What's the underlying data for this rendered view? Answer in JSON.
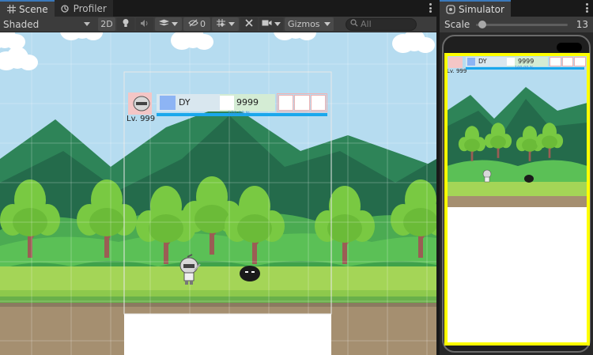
{
  "scene_tabs": [
    {
      "label": "Scene",
      "icon": "grid-icon",
      "active": true
    },
    {
      "label": "Profiler",
      "icon": "profiler-icon",
      "active": false
    }
  ],
  "simulator_tab": {
    "label": "Simulator",
    "icon": "simulator-icon"
  },
  "toolbar": {
    "shading_mode": "Shaded",
    "mode_2d": "2D",
    "hidden_count": "0",
    "gizmos": "Gizmos",
    "search_placeholder": "All"
  },
  "simulator": {
    "scale_label": "Scale",
    "scale_value": "13",
    "scale_fraction": 0.07
  },
  "game_ui": {
    "name": "DY",
    "number": "9999",
    "level": "Lv. 999",
    "exp_text": "100.00 %",
    "exp_fraction": 1.0
  },
  "colors": {
    "sky": "#b6dcf0",
    "mountain_dark": "#246b4b",
    "mountain_mid": "#2e8458",
    "grass": "#8dc94c",
    "ground": "#a58f70",
    "tree_leaf": "#79c942",
    "trunk": "#9b5d54",
    "safe_area": "#ffff00",
    "exp_bar": "#1aa7ec",
    "accent_tab": "#3a79bb"
  }
}
